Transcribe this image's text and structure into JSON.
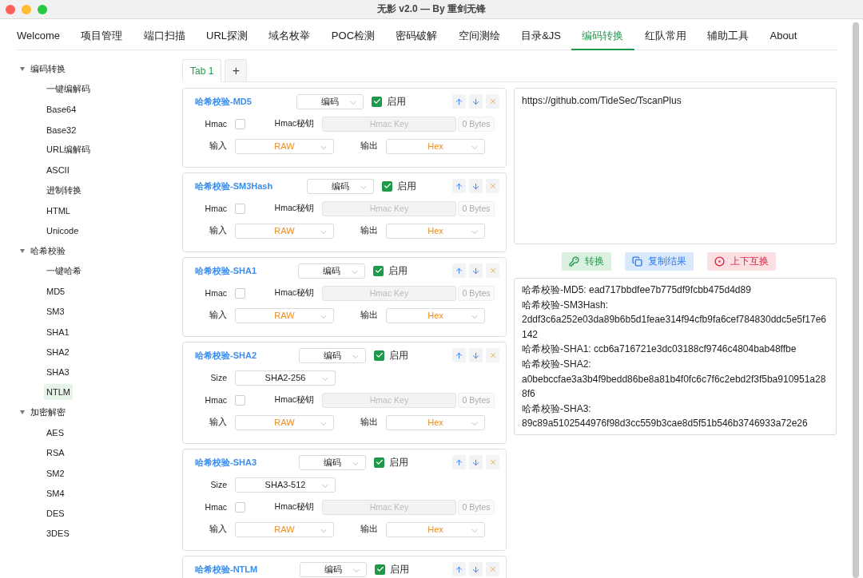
{
  "window": {
    "title": "无影 v2.0 — By 重剑无锋"
  },
  "nav": [
    {
      "label": "Welcome",
      "selected": false
    },
    {
      "label": "项目管理",
      "selected": false
    },
    {
      "label": "端口扫描",
      "selected": false
    },
    {
      "label": "URL探测",
      "selected": false
    },
    {
      "label": "域名枚举",
      "selected": false
    },
    {
      "label": "POC检测",
      "selected": false
    },
    {
      "label": "密码破解",
      "selected": false
    },
    {
      "label": "空间测绘",
      "selected": false
    },
    {
      "label": "目录&JS",
      "selected": false
    },
    {
      "label": "编码转换",
      "selected": true
    },
    {
      "label": "红队常用",
      "selected": false
    },
    {
      "label": "辅助工具",
      "selected": false
    },
    {
      "label": "About",
      "selected": false
    }
  ],
  "sidebar": [
    {
      "label": "编码转换",
      "expanded": true,
      "selected": false,
      "children": [
        {
          "label": "一键编解码",
          "selected": false
        },
        {
          "label": "Base64",
          "selected": false
        },
        {
          "label": "Base32",
          "selected": false
        },
        {
          "label": "URL编解码",
          "selected": false
        },
        {
          "label": "ASCII",
          "selected": false
        },
        {
          "label": "进制转换",
          "selected": false
        },
        {
          "label": "HTML",
          "selected": false
        },
        {
          "label": "Unicode",
          "selected": false
        }
      ]
    },
    {
      "label": "哈希校验",
      "expanded": true,
      "selected": false,
      "children": [
        {
          "label": "一键哈希",
          "selected": false
        },
        {
          "label": "MD5",
          "selected": false
        },
        {
          "label": "SM3",
          "selected": false
        },
        {
          "label": "SHA1",
          "selected": false
        },
        {
          "label": "SHA2",
          "selected": false
        },
        {
          "label": "SHA3",
          "selected": false
        },
        {
          "label": "NTLM",
          "selected": true
        }
      ]
    },
    {
      "label": "加密解密",
      "expanded": true,
      "selected": false,
      "children": [
        {
          "label": "AES",
          "selected": false
        },
        {
          "label": "RSA",
          "selected": false
        },
        {
          "label": "SM2",
          "selected": false
        },
        {
          "label": "SM4",
          "selected": false
        },
        {
          "label": "DES",
          "selected": false
        },
        {
          "label": "3DES",
          "selected": false
        }
      ]
    }
  ],
  "doc_tabs": [
    {
      "label": "Tab 1",
      "selected": true
    }
  ],
  "add_tab": "+",
  "cards": [
    {
      "title": "哈希校验-MD5",
      "mode": "编码",
      "enable_label": "启用",
      "enabled": true,
      "hmac_label": "Hmac",
      "hmac_checked": false,
      "key_label": "Hmac秘钥",
      "key_placeholder": "Hmac Key",
      "bytes": "0 Bytes",
      "input_label": "输入",
      "input": "RAW",
      "output_label": "输出",
      "output": "Hex"
    },
    {
      "title": "哈希校验-SM3Hash",
      "mode": "编码",
      "enable_label": "启用",
      "enabled": true,
      "hmac_label": "Hmac",
      "hmac_checked": false,
      "key_label": "Hmac秘钥",
      "key_placeholder": "Hmac Key",
      "bytes": "0 Bytes",
      "input_label": "输入",
      "input": "RAW",
      "output_label": "输出",
      "output": "Hex"
    },
    {
      "title": "哈希校验-SHA1",
      "mode": "编码",
      "enable_label": "启用",
      "enabled": true,
      "hmac_label": "Hmac",
      "hmac_checked": false,
      "key_label": "Hmac秘钥",
      "key_placeholder": "Hmac Key",
      "bytes": "0 Bytes",
      "input_label": "输入",
      "input": "RAW",
      "output_label": "输出",
      "output": "Hex"
    },
    {
      "title": "哈希校验-SHA2",
      "mode": "编码",
      "enable_label": "启用",
      "enabled": true,
      "size_label": "Size",
      "size": "SHA2-256",
      "hmac_label": "Hmac",
      "hmac_checked": false,
      "key_label": "Hmac秘钥",
      "key_placeholder": "Hmac Key",
      "bytes": "0 Bytes",
      "input_label": "输入",
      "input": "RAW",
      "output_label": "输出",
      "output": "Hex"
    },
    {
      "title": "哈希校验-SHA3",
      "mode": "编码",
      "enable_label": "启用",
      "enabled": true,
      "size_label": "Size",
      "size": "SHA3-512",
      "hmac_label": "Hmac",
      "hmac_checked": false,
      "key_label": "Hmac秘钥",
      "key_placeholder": "Hmac Key",
      "bytes": "0 Bytes",
      "input_label": "输入",
      "input": "RAW",
      "output_label": "输出",
      "output": "Hex"
    },
    {
      "title": "哈希校验-NTLM",
      "mode": "编码",
      "enable_label": "启用",
      "enabled": true
    }
  ],
  "input_text": "https://github.com/TideSec/TscanPlus",
  "actions": [
    {
      "kind": "convert",
      "label": "转换"
    },
    {
      "kind": "copy",
      "label": "复制结果"
    },
    {
      "kind": "swap",
      "label": "上下互换"
    }
  ],
  "output_lines": [
    "哈希校验-MD5: ead717bbdfee7b775df9fcbb475d4d89",
    "哈希校验-SM3Hash:",
    "2ddf3c6a252e03da89b6b5d1feae314f94cfb9fa6cef784830ddc5e5f17e6142",
    "哈希校验-SHA1: ccb6a716721e3dc03188cf9746c4804bab48ffbe",
    "哈希校验-SHA2:",
    "a0bebccfae3a3b4f9bedd86be8a81b4f0fc6c7f6c2ebd2f3f5ba910951a288f6",
    "哈希校验-SHA3:",
    "89c89a5102544976f98d3cc559b3cae8d5f51b546b3746933a72e26"
  ]
}
